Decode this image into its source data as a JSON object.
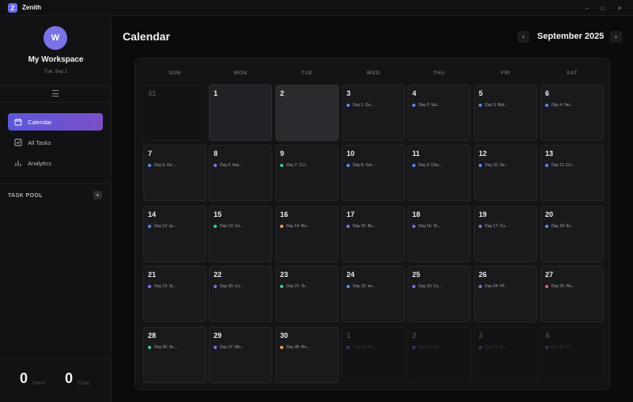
{
  "app": {
    "title": "Zenith",
    "logo_letter": "Z",
    "minimize": "–",
    "maximize": "□",
    "close": "×"
  },
  "sidebar": {
    "avatar_letter": "W",
    "workspace_name": "My Workspace",
    "date": "Tue, Sep 2",
    "nav": [
      {
        "label": "Calendar",
        "icon": "calendar-icon",
        "active": true
      },
      {
        "label": "All Tasks",
        "icon": "checkbox-icon",
        "active": false
      },
      {
        "label": "Analytics",
        "icon": "bar-chart-icon",
        "active": false
      }
    ],
    "pool_title": "TASK POOL",
    "pool_add": "+",
    "stats": {
      "open_count": "0",
      "open_label": "OPEN",
      "done_count": "0",
      "done_label": "DONE"
    }
  },
  "main": {
    "title": "Calendar",
    "month": "September 2025",
    "prev": "‹",
    "next": "›",
    "weekdays": [
      "SUN",
      "MON",
      "TUE",
      "WED",
      "THU",
      "FRI",
      "SAT"
    ],
    "colors": {
      "blue": "#5b8def",
      "purple": "#8a6fe8",
      "green": "#3ecf9a",
      "orange": "#f0a05a",
      "red": "#ef5b6a"
    },
    "days": [
      {
        "n": "31",
        "other": true
      },
      {
        "n": "1",
        "state": "hl2"
      },
      {
        "n": "2",
        "state": "hl"
      },
      {
        "n": "3",
        "task": "Day 1: Go ...",
        "color": "blue"
      },
      {
        "n": "4",
        "task": "Day 2: Val...",
        "color": "blue"
      },
      {
        "n": "5",
        "task": "Day 3: Mul...",
        "color": "blue"
      },
      {
        "n": "6",
        "task": "Day 4: Var...",
        "color": "blue"
      },
      {
        "n": "7",
        "task": "Day 5: Go ...",
        "color": "blue"
      },
      {
        "n": "8",
        "task": "Day 6: Imp...",
        "color": "purple"
      },
      {
        "n": "9",
        "task": "Day 7: CLI...",
        "color": "green"
      },
      {
        "n": "10",
        "task": "Day 8: Gor...",
        "color": "blue"
      },
      {
        "n": "11",
        "task": "Day 9: Cha...",
        "color": "blue"
      },
      {
        "n": "12",
        "task": "Day 10: Se...",
        "color": "blue"
      },
      {
        "n": "13",
        "task": "Day 11: Co...",
        "color": "blue"
      },
      {
        "n": "14",
        "task": "Day 12: sy...",
        "color": "blue"
      },
      {
        "n": "15",
        "task": "Day 13: Co...",
        "color": "green"
      },
      {
        "n": "16",
        "task": "Day 14: Re...",
        "color": "orange"
      },
      {
        "n": "17",
        "task": "Day 15: Bu...",
        "color": "purple"
      },
      {
        "n": "18",
        "task": "Day 16: St...",
        "color": "purple"
      },
      {
        "n": "19",
        "task": "Day 17: Cu...",
        "color": "purple"
      },
      {
        "n": "20",
        "task": "Day 18: Er...",
        "color": "blue"
      },
      {
        "n": "21",
        "task": "Day 19: Si...",
        "color": "purple"
      },
      {
        "n": "22",
        "task": "Day 20: Co...",
        "color": "purple"
      },
      {
        "n": "23",
        "task": "Day 21: Te...",
        "color": "green"
      },
      {
        "n": "24",
        "task": "Day 22: ne...",
        "color": "blue"
      },
      {
        "n": "25",
        "task": "Day 23: Cu...",
        "color": "purple"
      },
      {
        "n": "26",
        "task": "Day 24: HT...",
        "color": "purple"
      },
      {
        "n": "27",
        "task": "Day 25: Re...",
        "color": "red"
      },
      {
        "n": "28",
        "task": "Day 26: Sc...",
        "color": "green"
      },
      {
        "n": "29",
        "task": "Day 27: Wo...",
        "color": "purple"
      },
      {
        "n": "30",
        "task": "Day 28: Re...",
        "color": "orange"
      },
      {
        "n": "1",
        "other": true,
        "task": "Day 29: Ar...",
        "color": "purple"
      },
      {
        "n": "2",
        "other": true,
        "task": "Day 30: Bo...",
        "color": "purple"
      },
      {
        "n": "3",
        "other": true,
        "task": "Day 31: Di...",
        "color": "purple"
      },
      {
        "n": "4",
        "other": true,
        "task": "Day 32: Di...",
        "color": "purple"
      }
    ]
  }
}
